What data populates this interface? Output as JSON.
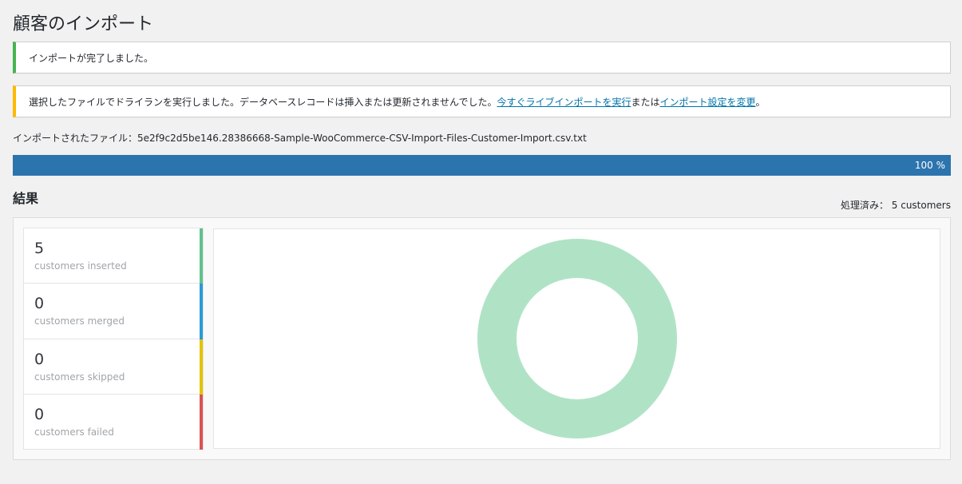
{
  "page": {
    "title": "顧客のインポート"
  },
  "notices": {
    "success": "インポートが完了しました。",
    "warning_text": "選択したファイルでドライランを実行しました。データベースレコードは挿入または更新されませんでした。 ",
    "warning_link1": "今すぐライブインポートを実行",
    "warning_mid": "または",
    "warning_link2": "インポート設定を変更",
    "warning_end": "。"
  },
  "file": {
    "label": "インポートされたファイル：",
    "name": "5e2f9c2d5be146.28386668-Sample-WooCommerce-CSV-Import-Files-Customer-Import.csv.txt"
  },
  "progress": {
    "value": 100,
    "label": "100 %"
  },
  "results": {
    "heading": "結果",
    "processed_label": "処理済み：",
    "processed_value": "5 customers",
    "stats": [
      {
        "value": "5",
        "label": "customers inserted",
        "color": "#62c28d"
      },
      {
        "value": "0",
        "label": "customers merged",
        "color": "#2a9ad6"
      },
      {
        "value": "0",
        "label": "customers skipped",
        "color": "#e5c300"
      },
      {
        "value": "0",
        "label": "customers failed",
        "color": "#d9534f"
      }
    ]
  },
  "chart_data": {
    "type": "pie",
    "donut": true,
    "categories": [
      "customers inserted",
      "customers merged",
      "customers skipped",
      "customers failed"
    ],
    "values": [
      5,
      0,
      0,
      0
    ],
    "colors": [
      "#b0e3c6",
      "#2a9ad6",
      "#e5c300",
      "#d9534f"
    ]
  }
}
